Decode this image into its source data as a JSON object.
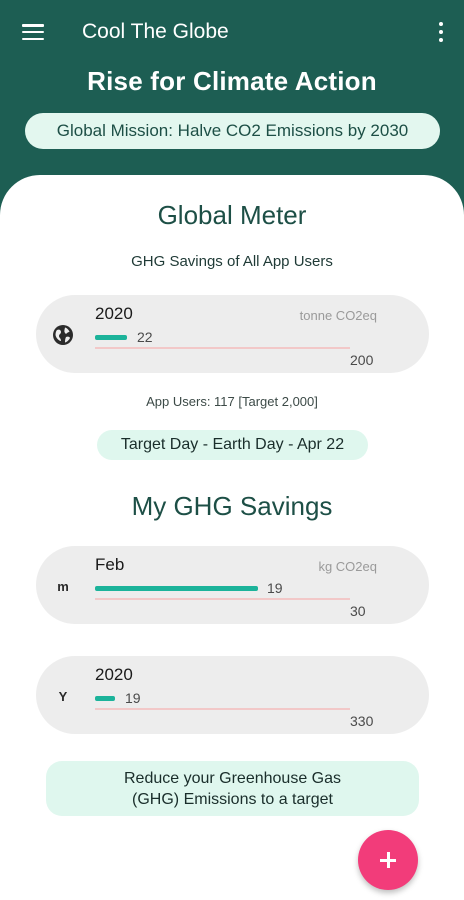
{
  "app": {
    "title": "Cool The Globe",
    "menu_icon": "hamburger-menu-icon",
    "more_icon": "more-vert-icon"
  },
  "header": {
    "headline": "Rise for Climate Action",
    "mission": "Global Mission: Halve CO2 Emissions by 2030"
  },
  "global_meter": {
    "title": "Global Meter",
    "subtitle": "GHG Savings of All App Users",
    "card": {
      "icon": "globe-icon",
      "period": "2020",
      "unit": "tonne CO2eq",
      "value": "22",
      "target": "200",
      "progress": 0.11
    },
    "app_users": "App Users: 117  [Target 2,000]",
    "target_day": "Target Day - Earth Day - Apr 22"
  },
  "my_savings": {
    "title": "My GHG Savings",
    "monthly": {
      "icon": "m",
      "icon_name": "month-letter-icon",
      "period": "Feb",
      "unit": "kg CO2eq",
      "value": "19",
      "target": "30",
      "progress": 0.63
    },
    "yearly": {
      "icon": "Y",
      "icon_name": "year-letter-icon",
      "period": "2020",
      "unit": "",
      "value": "19",
      "target": "330",
      "progress": 0.06
    }
  },
  "reduce_prompt": {
    "line1": "Reduce your Greenhouse Gas",
    "line2": "(GHG) Emissions to a target"
  },
  "fab": {
    "icon": "plus-icon"
  },
  "colors": {
    "primary": "#1d5e53",
    "accent": "#1cb39a",
    "fab": "#f23c7a",
    "pill_bg": "#dff7ee",
    "card_bg": "#ededed",
    "track": "#f2c8c8"
  }
}
